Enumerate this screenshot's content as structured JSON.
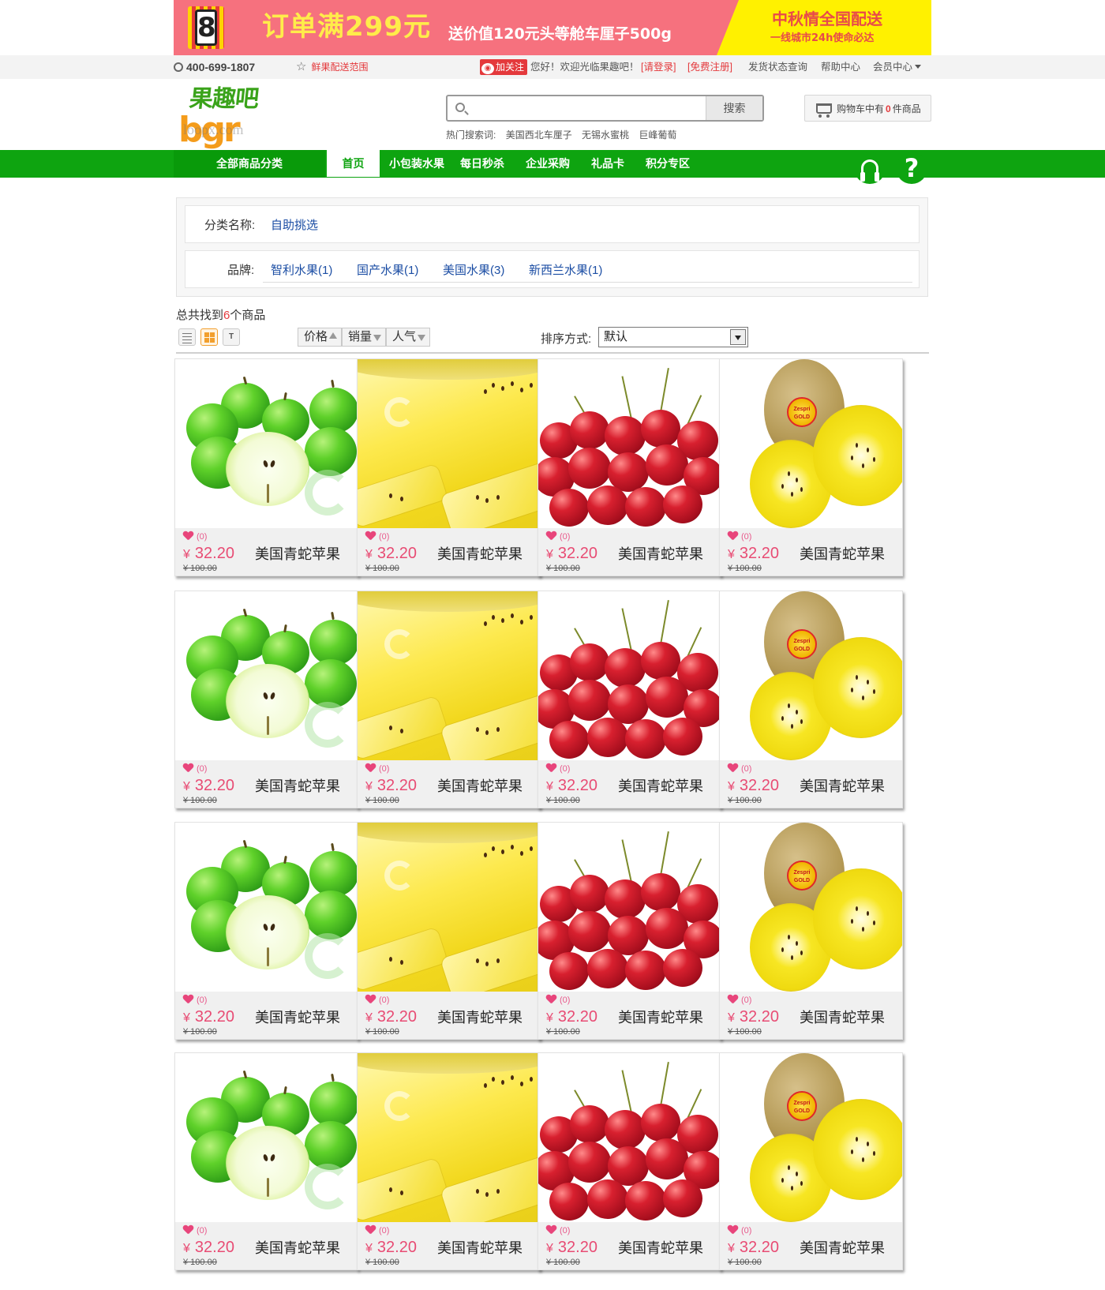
{
  "banner": {
    "badge": "8",
    "headline": "订单满299元",
    "sub": "送价值120元头等舱车厘子500g",
    "right_line1": "中秋情全国配送",
    "right_line2": "一线城市24h使命必达"
  },
  "util": {
    "phone": "400-699-1807",
    "delivery": "鲜果配送范围",
    "follow": "加关注",
    "welcome": "您好！欢迎光临果趣吧！",
    "login": "[请登录]",
    "register": "[免费注册]",
    "links": [
      "发货状态查询",
      "帮助中心",
      "会员中心"
    ]
  },
  "logo": {
    "cn": "果趣吧",
    "en": "bgr",
    "watermark": "loopx.com"
  },
  "search": {
    "placeholder": "",
    "button": "搜索",
    "hot_label": "热门搜索词:",
    "hot_keywords": [
      "美国西北车厘子",
      "无锡水蜜桃",
      "巨峰葡萄"
    ]
  },
  "cart": {
    "prefix": "购物车中有",
    "count": "0",
    "suffix": "件商品"
  },
  "nav": {
    "all": "全部商品分类",
    "items": [
      "首页",
      "小包装水果",
      "每日秒杀",
      "企业采购",
      "礼品卡",
      "积分专区"
    ],
    "active_index": 0,
    "icons": [
      "headset-icon",
      "help-icon"
    ]
  },
  "filter": {
    "category_label": "分类名称:",
    "category_value": "自助挑选",
    "brand_label": "品牌:",
    "brands": [
      "智利水果(1)",
      "国产水果(1)",
      "美国水果(3)",
      "新西兰水果(1)"
    ]
  },
  "results": {
    "prefix": "总共找到",
    "count": "6",
    "suffix": "个商品"
  },
  "toolbar": {
    "view_modes": [
      "list-view-icon",
      "grid-view-icon",
      "text-view-icon"
    ],
    "sorts": [
      "价格",
      "销量",
      "人气"
    ],
    "sort_label": "排序方式:",
    "sort_value": "默认"
  },
  "products": [
    {
      "image": "green-apple",
      "likes": "(0)",
      "currency": "¥",
      "price": "32.20",
      "name": "美国青蛇苹果",
      "old_price": "¥ 100.00"
    },
    {
      "image": "golden-kiwi-slices",
      "likes": "(0)",
      "currency": "¥",
      "price": "32.20",
      "name": "美国青蛇苹果",
      "old_price": "¥ 100.00"
    },
    {
      "image": "cherries",
      "likes": "(0)",
      "currency": "¥",
      "price": "32.20",
      "name": "美国青蛇苹果",
      "old_price": "¥ 100.00"
    },
    {
      "image": "zespri-gold-kiwi",
      "likes": "(0)",
      "currency": "¥",
      "price": "32.20",
      "name": "美国青蛇苹果",
      "old_price": "¥ 100.00"
    },
    {
      "image": "green-apple",
      "likes": "(0)",
      "currency": "¥",
      "price": "32.20",
      "name": "美国青蛇苹果",
      "old_price": "¥ 100.00"
    },
    {
      "image": "golden-kiwi-slices",
      "likes": "(0)",
      "currency": "¥",
      "price": "32.20",
      "name": "美国青蛇苹果",
      "old_price": "¥ 100.00"
    },
    {
      "image": "cherries",
      "likes": "(0)",
      "currency": "¥",
      "price": "32.20",
      "name": "美国青蛇苹果",
      "old_price": "¥ 100.00"
    },
    {
      "image": "zespri-gold-kiwi",
      "likes": "(0)",
      "currency": "¥",
      "price": "32.20",
      "name": "美国青蛇苹果",
      "old_price": "¥ 100.00"
    },
    {
      "image": "green-apple",
      "likes": "(0)",
      "currency": "¥",
      "price": "32.20",
      "name": "美国青蛇苹果",
      "old_price": "¥ 100.00"
    },
    {
      "image": "golden-kiwi-slices",
      "likes": "(0)",
      "currency": "¥",
      "price": "32.20",
      "name": "美国青蛇苹果",
      "old_price": "¥ 100.00"
    },
    {
      "image": "cherries",
      "likes": "(0)",
      "currency": "¥",
      "price": "32.20",
      "name": "美国青蛇苹果",
      "old_price": "¥ 100.00"
    },
    {
      "image": "zespri-gold-kiwi",
      "likes": "(0)",
      "currency": "¥",
      "price": "32.20",
      "name": "美国青蛇苹果",
      "old_price": "¥ 100.00"
    },
    {
      "image": "green-apple",
      "likes": "(0)",
      "currency": "¥",
      "price": "32.20",
      "name": "美国青蛇苹果",
      "old_price": "¥ 100.00"
    },
    {
      "image": "golden-kiwi-slices",
      "likes": "(0)",
      "currency": "¥",
      "price": "32.20",
      "name": "美国青蛇苹果",
      "old_price": "¥ 100.00"
    },
    {
      "image": "cherries",
      "likes": "(0)",
      "currency": "¥",
      "price": "32.20",
      "name": "美国青蛇苹果",
      "old_price": "¥ 100.00"
    },
    {
      "image": "zespri-gold-kiwi",
      "likes": "(0)",
      "currency": "¥",
      "price": "32.20",
      "name": "美国青蛇苹果",
      "old_price": "¥ 100.00"
    }
  ],
  "colors": {
    "nav_green": "#0ea410",
    "price_pink": "#e84c74",
    "accent_red": "#e4393c",
    "link_blue": "#1c4ea4",
    "banner_pink": "#f6717e",
    "banner_yellow": "#fff100"
  }
}
